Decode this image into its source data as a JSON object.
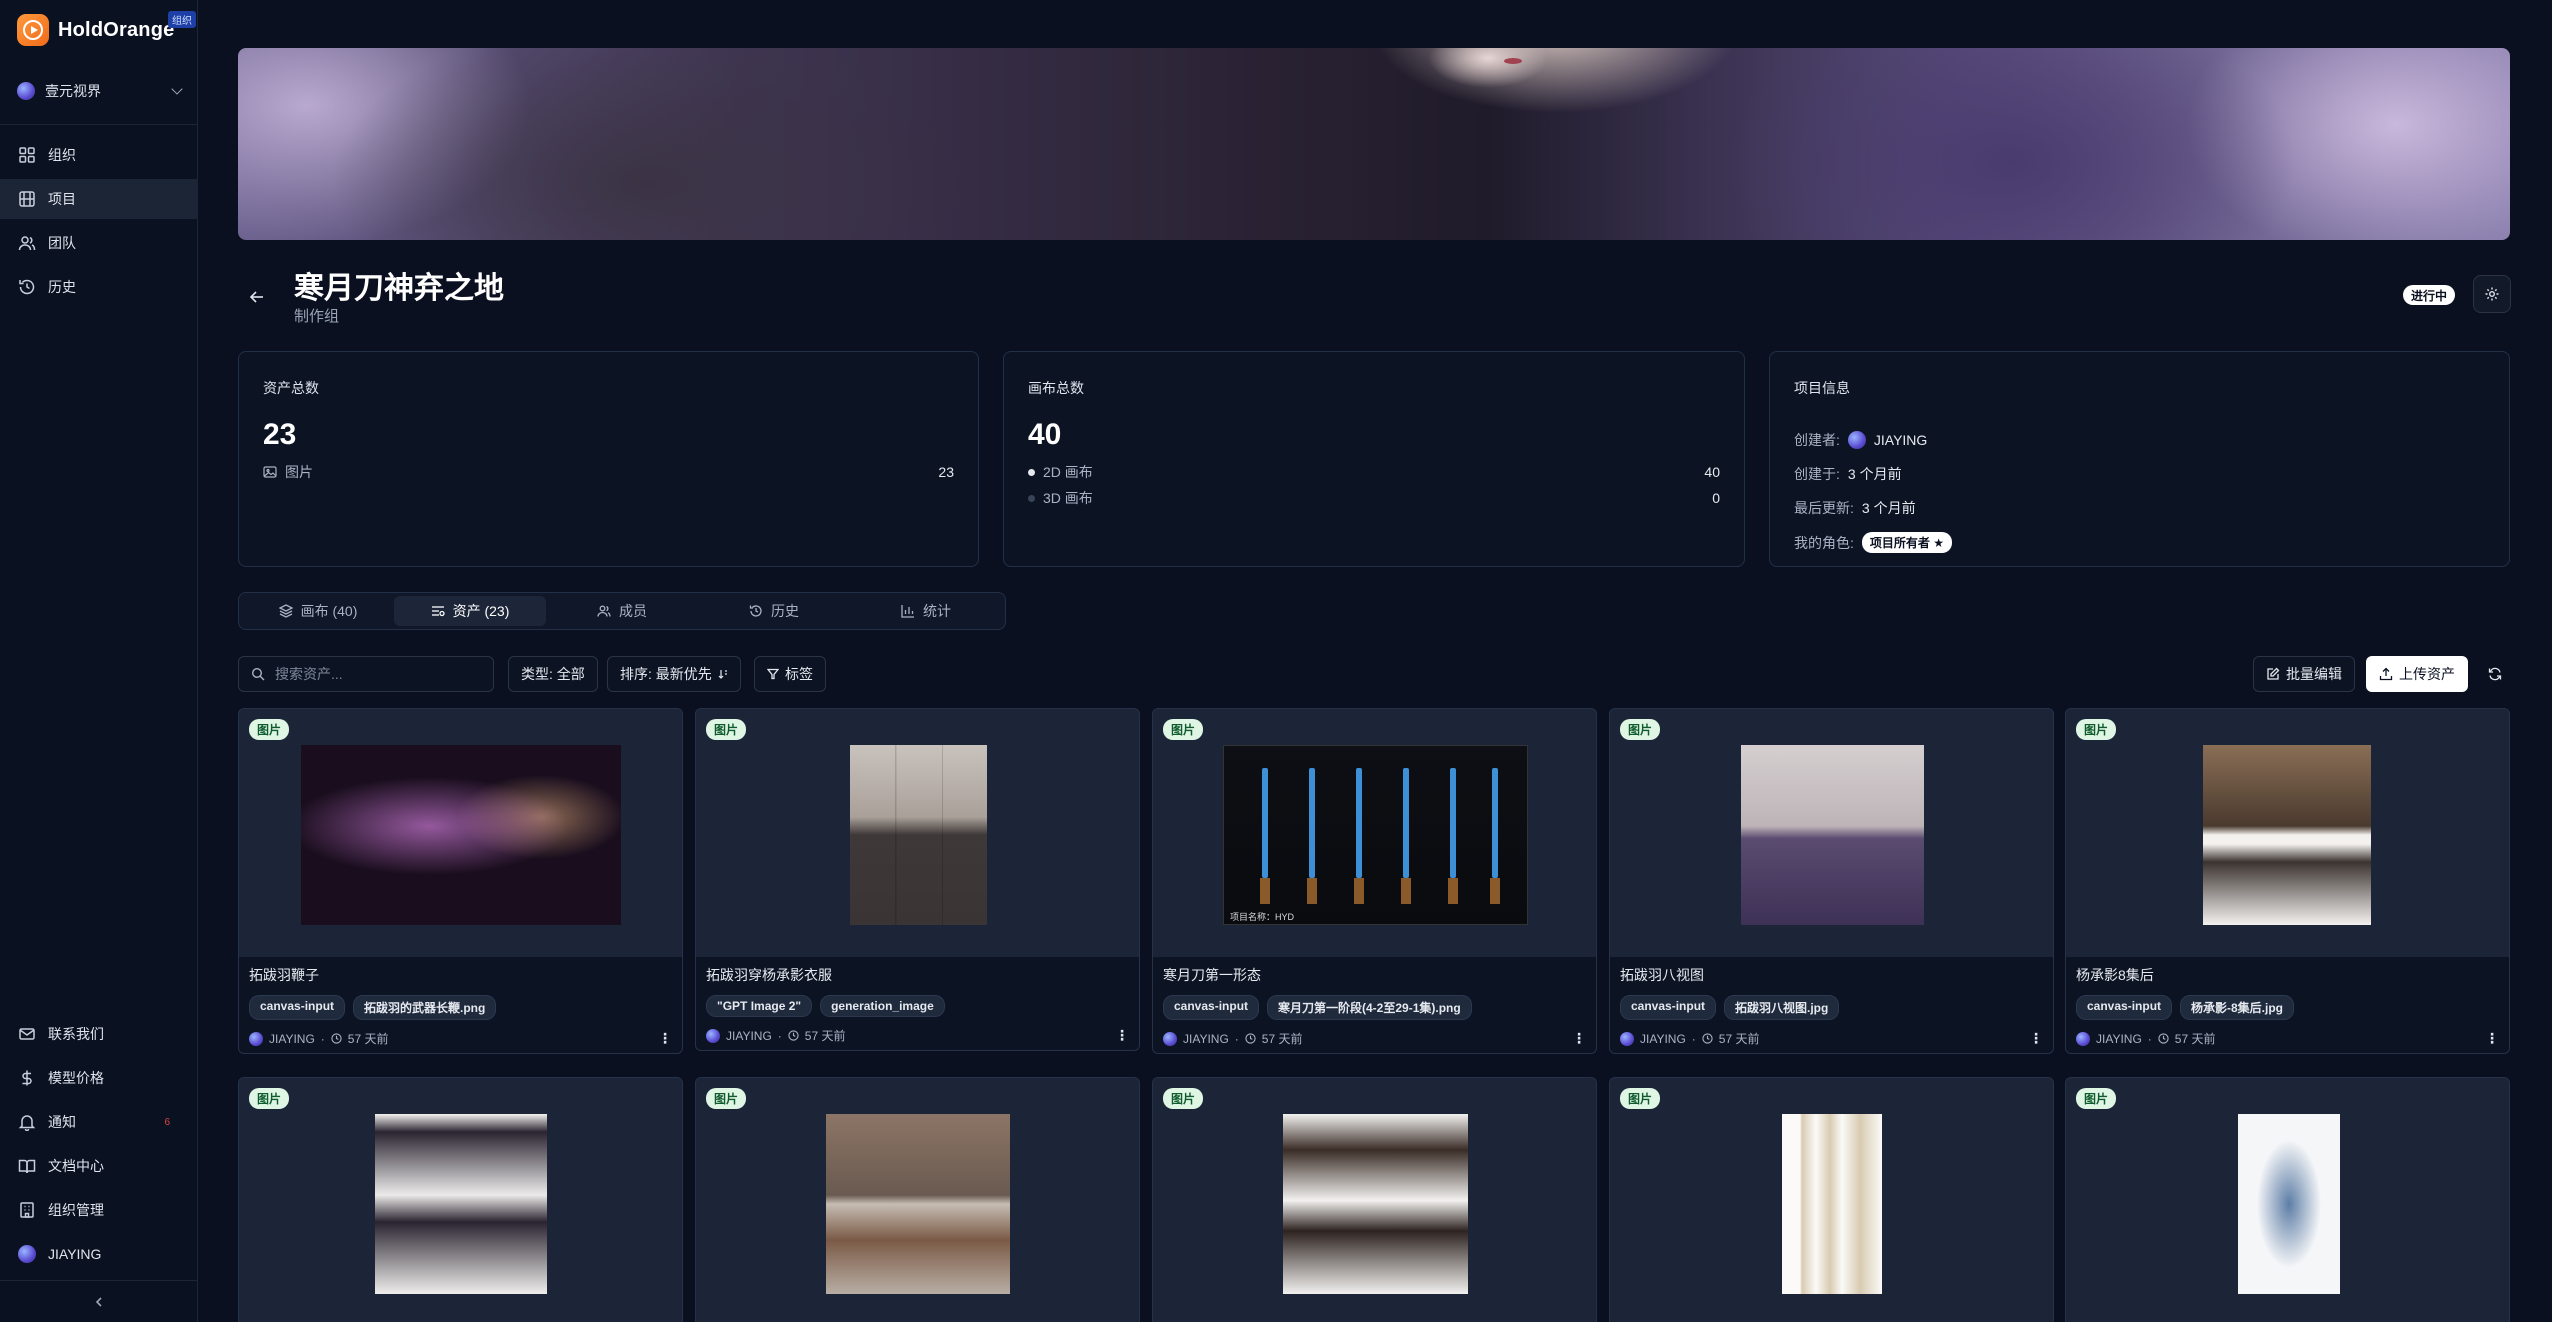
{
  "app": {
    "name": "HoldOrange",
    "badge": "组织"
  },
  "org": {
    "name": "壹元视界"
  },
  "nav": {
    "top": [
      {
        "label": "组织",
        "icon": "grid-icon"
      },
      {
        "label": "项目",
        "icon": "film-icon"
      },
      {
        "label": "团队",
        "icon": "users-icon"
      },
      {
        "label": "历史",
        "icon": "history-icon"
      }
    ],
    "bottom": [
      {
        "label": "联系我们",
        "icon": "mail-icon"
      },
      {
        "label": "模型价格",
        "icon": "dollar-icon"
      },
      {
        "label": "通知",
        "icon": "bell-icon",
        "count": "6"
      },
      {
        "label": "文档中心",
        "icon": "book-icon"
      },
      {
        "label": "组织管理",
        "icon": "building-icon"
      },
      {
        "label": "JIAYING",
        "icon": "avatar"
      }
    ]
  },
  "project": {
    "title": "寒月刀神弃之地",
    "subtitle": "制作组",
    "status": "进行中"
  },
  "stats": {
    "assets": {
      "label": "资产总数",
      "total": "23",
      "rows": [
        {
          "label": "图片",
          "value": "23"
        }
      ]
    },
    "canvas": {
      "label": "画布总数",
      "total": "40",
      "rows": [
        {
          "label": "2D 画布",
          "value": "40"
        },
        {
          "label": "3D 画布",
          "value": "0"
        }
      ]
    },
    "info": {
      "label": "项目信息",
      "creator_label": "创建者:",
      "creator": "JIAYING",
      "created_label": "创建于:",
      "created": "3 个月前",
      "updated_label": "最后更新:",
      "updated": "3 个月前",
      "role_label": "我的角色:",
      "role": "项目所有者 ★"
    }
  },
  "tabs": [
    {
      "label": "画布 (40)",
      "icon": "layers-icon"
    },
    {
      "label": "资产 (23)",
      "icon": "assets-icon",
      "active": true
    },
    {
      "label": "成员",
      "icon": "users-icon"
    },
    {
      "label": "历史",
      "icon": "history-icon"
    },
    {
      "label": "统计",
      "icon": "chart-icon"
    }
  ],
  "toolbar": {
    "search_placeholder": "搜索资产...",
    "type_filter": "类型: 全部",
    "sort": "排序: 最新优先",
    "tags": "标签",
    "batch_edit": "批量编辑",
    "upload": "上传资产"
  },
  "assets": [
    {
      "badge": "图片",
      "title": "拓跋羽鞭子",
      "tags": [
        "canvas-input",
        "拓跋羽的武器长鞭.png"
      ],
      "author": "JIAYING",
      "time": "57 天前"
    },
    {
      "badge": "图片",
      "title": "拓跋羽穿杨承影衣服",
      "tags": [
        "\"GPT Image 2\"",
        "generation_image"
      ],
      "author": "JIAYING",
      "time": "57 天前"
    },
    {
      "badge": "图片",
      "title": "寒月刀第一形态",
      "tags": [
        "canvas-input",
        "寒月刀第一阶段(4-2至29-1集).png"
      ],
      "author": "JIAYING",
      "time": "57 天前",
      "img_label": "项目名称：HYD"
    },
    {
      "badge": "图片",
      "title": "拓跋羽八视图",
      "tags": [
        "canvas-input",
        "拓跋羽八视图.jpg"
      ],
      "author": "JIAYING",
      "time": "57 天前"
    },
    {
      "badge": "图片",
      "title": "杨承影8集后",
      "tags": [
        "canvas-input",
        "杨承影-8集后.jpg"
      ],
      "author": "JIAYING",
      "time": "57 天前"
    },
    {
      "badge": "图片"
    },
    {
      "badge": "图片"
    },
    {
      "badge": "图片"
    },
    {
      "badge": "图片"
    },
    {
      "badge": "图片"
    }
  ]
}
